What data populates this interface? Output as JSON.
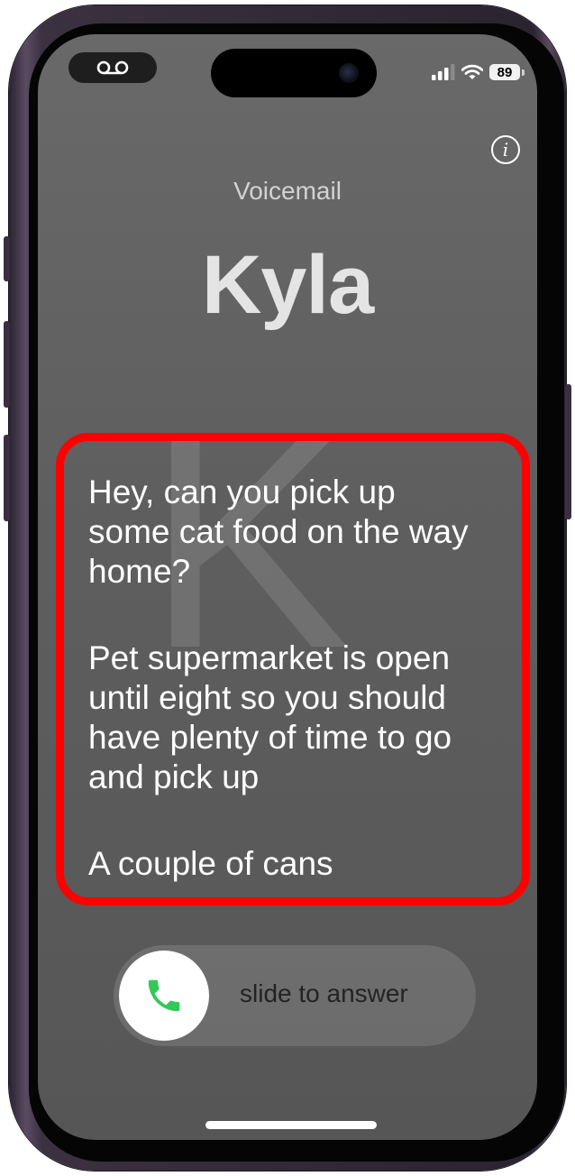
{
  "status_bar": {
    "voicemail_icon": "voicemail-icon",
    "signal_icon": "cellular-signal-icon",
    "wifi_icon": "wifi-icon",
    "battery_level": "89"
  },
  "call": {
    "label": "Voicemail",
    "contact_name": "Kyla",
    "monogram": "K",
    "info_icon": "info-icon"
  },
  "transcript": {
    "paragraphs": [
      "Hey, can you pick up some cat food on the way home?",
      "Pet supermarket is open until eight so you should have plenty of time to go and pick up",
      "A couple of cans"
    ],
    "highlight_color": "#ff0000"
  },
  "answer": {
    "label": "slide to answer",
    "icon": "phone-icon",
    "icon_color": "#34c759"
  }
}
